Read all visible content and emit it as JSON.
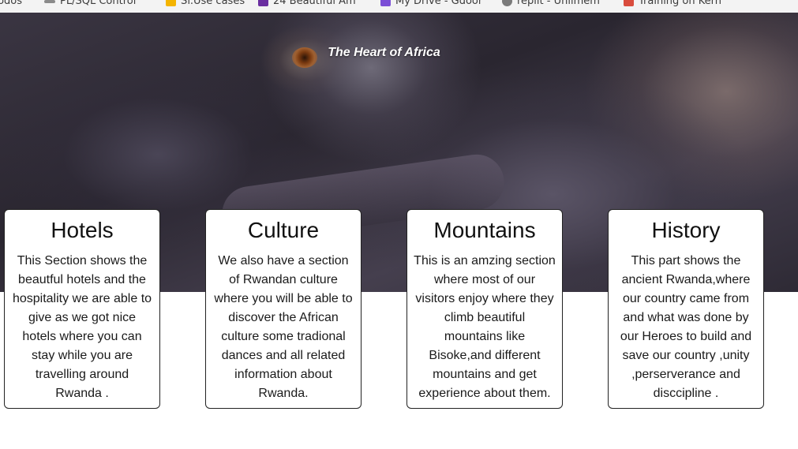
{
  "bookmarks": [
    {
      "label": "todos",
      "icon": "none",
      "color": "#3c3c3c"
    },
    {
      "label": "PL/SQL Control",
      "icon": "link-icon",
      "color": "#6a6a6a"
    },
    {
      "label": "Sf.Use cases",
      "icon": "drive-icon",
      "color": "#f4b400"
    },
    {
      "label": "24 Beautiful Am",
      "icon": "bookmark-icon",
      "color": "#6a2ea0"
    },
    {
      "label": "My Drive - Gdoor",
      "icon": "drive-icon",
      "color": "#7b4fd6"
    },
    {
      "label": "replit - Unlimem",
      "icon": "globe-icon",
      "color": "#7a7a7a"
    },
    {
      "label": "Training on Kern",
      "icon": "bookmark-icon",
      "color": "#d94c3d"
    }
  ],
  "hero": {
    "title": "The Heart of Africa"
  },
  "cards": [
    {
      "title": "Hotels",
      "text": "This Section shows the beautful hotels and the hospitality we are able to give as we got nice hotels where you can stay while you are travelling around Rwanda ."
    },
    {
      "title": "Culture",
      "text": "We also have a section of Rwandan culture where you will be able to discover the African culture some tradional dances and all related information about Rwanda."
    },
    {
      "title": "Mountains",
      "text": "This is an amzing section where most of our visitors enjoy where they climb beautiful mountains like Bisoke,and different mountains and get experience about them."
    },
    {
      "title": "History",
      "text": "This part shows the ancient Rwanda,where our country came from and what was done by our Heroes to build and save our country ,unity ,perserverance and disccipline ."
    }
  ]
}
